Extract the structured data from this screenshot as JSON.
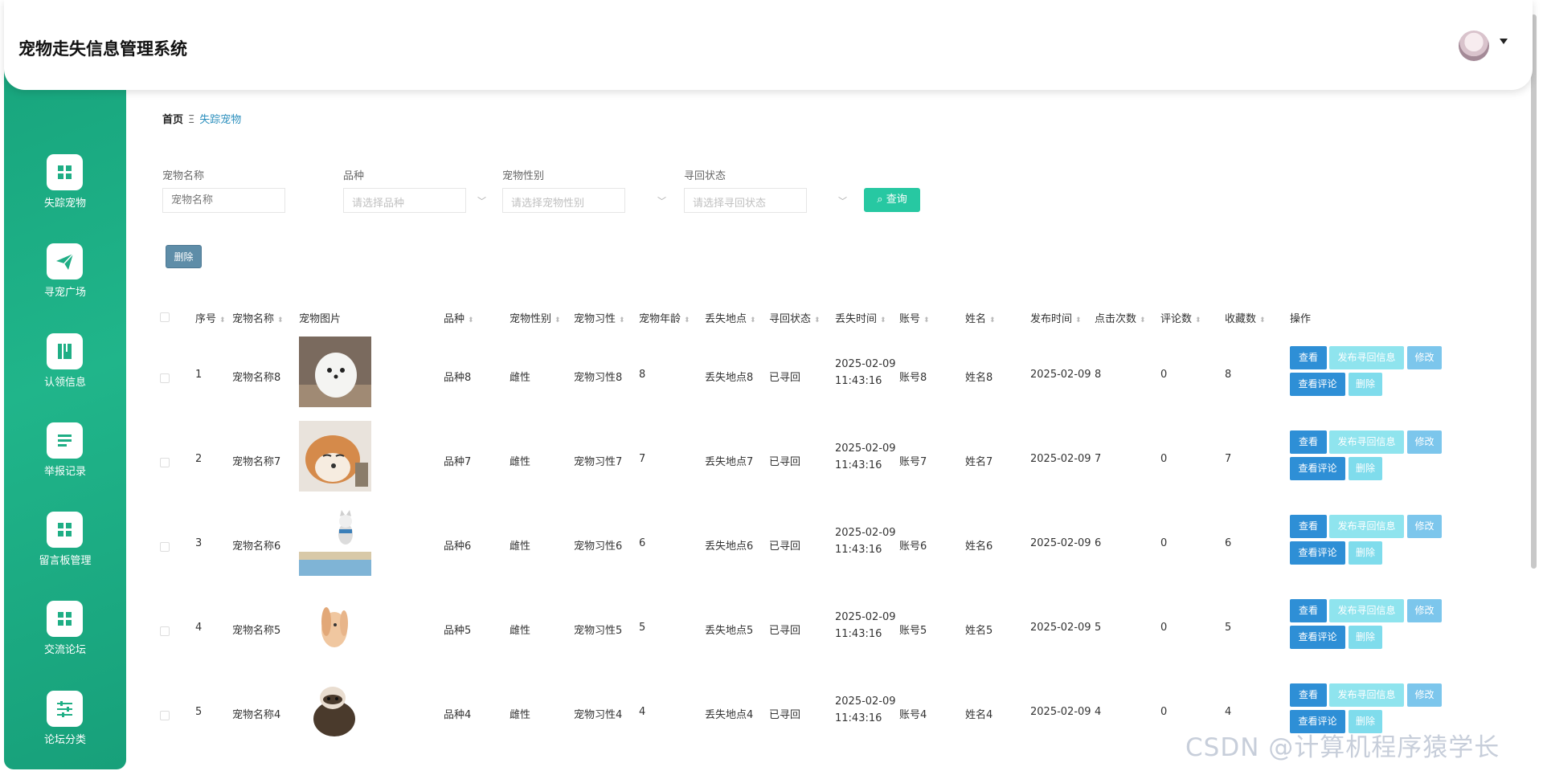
{
  "header": {
    "title": "宠物走失信息管理系统"
  },
  "sidebar": {
    "items": [
      {
        "label": "失踪宠物",
        "icon": "grid-icon"
      },
      {
        "label": "寻宠广场",
        "icon": "paper-plane-icon"
      },
      {
        "label": "认领信息",
        "icon": "book-icon"
      },
      {
        "label": "举报记录",
        "icon": "list-icon"
      },
      {
        "label": "留言板管理",
        "icon": "grid-icon"
      },
      {
        "label": "交流论坛",
        "icon": "grid-icon"
      },
      {
        "label": "论坛分类",
        "icon": "sliders-icon"
      }
    ]
  },
  "breadcrumb": {
    "home": "首页",
    "separator": "Ξ",
    "current": "失踪宠物"
  },
  "filters": {
    "name_label": "宠物名称",
    "name_placeholder": "宠物名称",
    "breed_label": "品种",
    "breed_placeholder": "请选择品种",
    "gender_label": "宠物性别",
    "gender_placeholder": "请选择宠物性别",
    "status_label": "寻回状态",
    "status_placeholder": "请选择寻回状态",
    "query_label": "查询"
  },
  "actions": {
    "delete_label": "删除"
  },
  "table": {
    "columns": [
      "序号",
      "宠物名称",
      "宠物图片",
      "品种",
      "宠物性别",
      "宠物习性",
      "宠物年龄",
      "丢失地点",
      "寻回状态",
      "丢失时间",
      "账号",
      "姓名",
      "发布时间",
      "点击次数",
      "评论数",
      "收藏数",
      "操作"
    ],
    "ops": {
      "view": "查看",
      "publish": "发布寻回信息",
      "edit": "修改",
      "comments": "查看评论",
      "delete": "删除"
    },
    "rows": [
      {
        "no": "1",
        "name": "宠物名称8",
        "breed": "品种8",
        "gender": "雌性",
        "habit": "宠物习性8",
        "age": "8",
        "place": "丢失地点8",
        "status": "已寻回",
        "lost_date": "2025-02-09",
        "lost_time": "11:43:16",
        "account": "账号8",
        "person": "姓名8",
        "publish": "2025-02-09",
        "clicks": "8",
        "comments": "0",
        "favorites": "8",
        "image": "white-pomeranian"
      },
      {
        "no": "2",
        "name": "宠物名称7",
        "breed": "品种7",
        "gender": "雌性",
        "habit": "宠物习性7",
        "age": "7",
        "place": "丢失地点7",
        "status": "已寻回",
        "lost_date": "2025-02-09",
        "lost_time": "11:43:16",
        "account": "账号7",
        "person": "姓名7",
        "publish": "2025-02-09",
        "clicks": "7",
        "comments": "0",
        "favorites": "7",
        "image": "shiba-dog"
      },
      {
        "no": "3",
        "name": "宠物名称6",
        "breed": "品种6",
        "gender": "雌性",
        "habit": "宠物习性6",
        "age": "6",
        "place": "丢失地点6",
        "status": "已寻回",
        "lost_date": "2025-02-09",
        "lost_time": "11:43:16",
        "account": "账号6",
        "person": "姓名6",
        "publish": "2025-02-09",
        "clicks": "6",
        "comments": "0",
        "favorites": "6",
        "image": "cat-on-wall"
      },
      {
        "no": "4",
        "name": "宠物名称5",
        "breed": "品种5",
        "gender": "雌性",
        "habit": "宠物习性5",
        "age": "5",
        "place": "丢失地点5",
        "status": "已寻回",
        "lost_date": "2025-02-09",
        "lost_time": "11:43:16",
        "account": "账号5",
        "person": "姓名5",
        "publish": "2025-02-09",
        "clicks": "5",
        "comments": "0",
        "favorites": "5",
        "image": "rabbit"
      },
      {
        "no": "5",
        "name": "宠物名称4",
        "breed": "品种4",
        "gender": "雌性",
        "habit": "宠物习性4",
        "age": "4",
        "place": "丢失地点4",
        "status": "已寻回",
        "lost_date": "2025-02-09",
        "lost_time": "11:43:16",
        "account": "账号4",
        "person": "姓名4",
        "publish": "2025-02-09",
        "clicks": "4",
        "comments": "0",
        "favorites": "4",
        "image": "ferret"
      }
    ]
  },
  "watermark": "CSDN @计算机程序猿学长",
  "colors": {
    "sidebar": "#1fae85",
    "query_button": "#27c8a2",
    "view_button": "#2e8fd6",
    "breadcrumb_current": "#2b8fbd"
  }
}
